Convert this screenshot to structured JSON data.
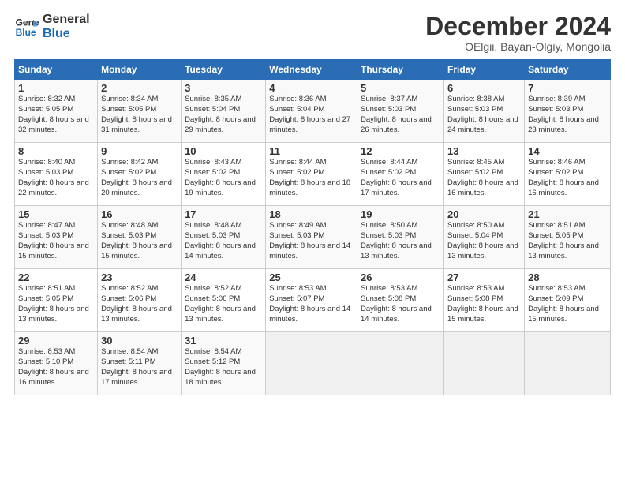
{
  "logo": {
    "line1": "General",
    "line2": "Blue"
  },
  "title": "December 2024",
  "subtitle": "OElgii, Bayan-Olgiy, Mongolia",
  "weekdays": [
    "Sunday",
    "Monday",
    "Tuesday",
    "Wednesday",
    "Thursday",
    "Friday",
    "Saturday"
  ],
  "weeks": [
    [
      {
        "day": "1",
        "rise": "Sunrise: 8:32 AM",
        "set": "Sunset: 5:05 PM",
        "daylight": "Daylight: 8 hours and 32 minutes."
      },
      {
        "day": "2",
        "rise": "Sunrise: 8:34 AM",
        "set": "Sunset: 5:05 PM",
        "daylight": "Daylight: 8 hours and 31 minutes."
      },
      {
        "day": "3",
        "rise": "Sunrise: 8:35 AM",
        "set": "Sunset: 5:04 PM",
        "daylight": "Daylight: 8 hours and 29 minutes."
      },
      {
        "day": "4",
        "rise": "Sunrise: 8:36 AM",
        "set": "Sunset: 5:04 PM",
        "daylight": "Daylight: 8 hours and 27 minutes."
      },
      {
        "day": "5",
        "rise": "Sunrise: 8:37 AM",
        "set": "Sunset: 5:03 PM",
        "daylight": "Daylight: 8 hours and 26 minutes."
      },
      {
        "day": "6",
        "rise": "Sunrise: 8:38 AM",
        "set": "Sunset: 5:03 PM",
        "daylight": "Daylight: 8 hours and 24 minutes."
      },
      {
        "day": "7",
        "rise": "Sunrise: 8:39 AM",
        "set": "Sunset: 5:03 PM",
        "daylight": "Daylight: 8 hours and 23 minutes."
      }
    ],
    [
      {
        "day": "8",
        "rise": "Sunrise: 8:40 AM",
        "set": "Sunset: 5:03 PM",
        "daylight": "Daylight: 8 hours and 22 minutes."
      },
      {
        "day": "9",
        "rise": "Sunrise: 8:42 AM",
        "set": "Sunset: 5:02 PM",
        "daylight": "Daylight: 8 hours and 20 minutes."
      },
      {
        "day": "10",
        "rise": "Sunrise: 8:43 AM",
        "set": "Sunset: 5:02 PM",
        "daylight": "Daylight: 8 hours and 19 minutes."
      },
      {
        "day": "11",
        "rise": "Sunrise: 8:44 AM",
        "set": "Sunset: 5:02 PM",
        "daylight": "Daylight: 8 hours and 18 minutes."
      },
      {
        "day": "12",
        "rise": "Sunrise: 8:44 AM",
        "set": "Sunset: 5:02 PM",
        "daylight": "Daylight: 8 hours and 17 minutes."
      },
      {
        "day": "13",
        "rise": "Sunrise: 8:45 AM",
        "set": "Sunset: 5:02 PM",
        "daylight": "Daylight: 8 hours and 16 minutes."
      },
      {
        "day": "14",
        "rise": "Sunrise: 8:46 AM",
        "set": "Sunset: 5:02 PM",
        "daylight": "Daylight: 8 hours and 16 minutes."
      }
    ],
    [
      {
        "day": "15",
        "rise": "Sunrise: 8:47 AM",
        "set": "Sunset: 5:03 PM",
        "daylight": "Daylight: 8 hours and 15 minutes."
      },
      {
        "day": "16",
        "rise": "Sunrise: 8:48 AM",
        "set": "Sunset: 5:03 PM",
        "daylight": "Daylight: 8 hours and 15 minutes."
      },
      {
        "day": "17",
        "rise": "Sunrise: 8:48 AM",
        "set": "Sunset: 5:03 PM",
        "daylight": "Daylight: 8 hours and 14 minutes."
      },
      {
        "day": "18",
        "rise": "Sunrise: 8:49 AM",
        "set": "Sunset: 5:03 PM",
        "daylight": "Daylight: 8 hours and 14 minutes."
      },
      {
        "day": "19",
        "rise": "Sunrise: 8:50 AM",
        "set": "Sunset: 5:03 PM",
        "daylight": "Daylight: 8 hours and 13 minutes."
      },
      {
        "day": "20",
        "rise": "Sunrise: 8:50 AM",
        "set": "Sunset: 5:04 PM",
        "daylight": "Daylight: 8 hours and 13 minutes."
      },
      {
        "day": "21",
        "rise": "Sunrise: 8:51 AM",
        "set": "Sunset: 5:05 PM",
        "daylight": "Daylight: 8 hours and 13 minutes."
      }
    ],
    [
      {
        "day": "22",
        "rise": "Sunrise: 8:51 AM",
        "set": "Sunset: 5:05 PM",
        "daylight": "Daylight: 8 hours and 13 minutes."
      },
      {
        "day": "23",
        "rise": "Sunrise: 8:52 AM",
        "set": "Sunset: 5:06 PM",
        "daylight": "Daylight: 8 hours and 13 minutes."
      },
      {
        "day": "24",
        "rise": "Sunrise: 8:52 AM",
        "set": "Sunset: 5:06 PM",
        "daylight": "Daylight: 8 hours and 13 minutes."
      },
      {
        "day": "25",
        "rise": "Sunrise: 8:53 AM",
        "set": "Sunset: 5:07 PM",
        "daylight": "Daylight: 8 hours and 14 minutes."
      },
      {
        "day": "26",
        "rise": "Sunrise: 8:53 AM",
        "set": "Sunset: 5:08 PM",
        "daylight": "Daylight: 8 hours and 14 minutes."
      },
      {
        "day": "27",
        "rise": "Sunrise: 8:53 AM",
        "set": "Sunset: 5:08 PM",
        "daylight": "Daylight: 8 hours and 15 minutes."
      },
      {
        "day": "28",
        "rise": "Sunrise: 8:53 AM",
        "set": "Sunset: 5:09 PM",
        "daylight": "Daylight: 8 hours and 15 minutes."
      }
    ],
    [
      {
        "day": "29",
        "rise": "Sunrise: 8:53 AM",
        "set": "Sunset: 5:10 PM",
        "daylight": "Daylight: 8 hours and 16 minutes."
      },
      {
        "day": "30",
        "rise": "Sunrise: 8:54 AM",
        "set": "Sunset: 5:11 PM",
        "daylight": "Daylight: 8 hours and 17 minutes."
      },
      {
        "day": "31",
        "rise": "Sunrise: 8:54 AM",
        "set": "Sunset: 5:12 PM",
        "daylight": "Daylight: 8 hours and 18 minutes."
      },
      null,
      null,
      null,
      null
    ]
  ]
}
